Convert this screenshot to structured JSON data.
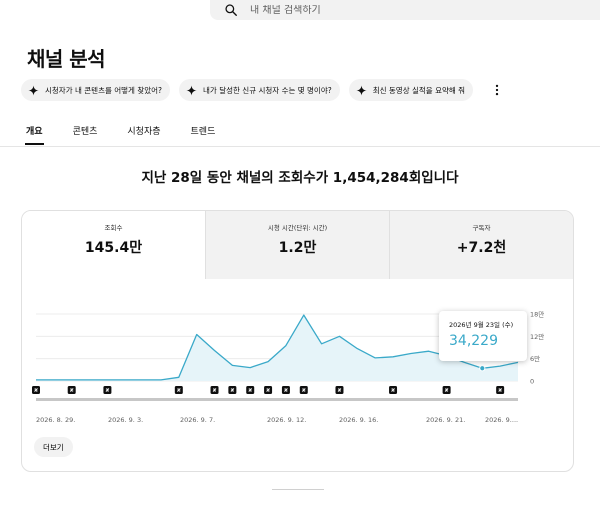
{
  "search": {
    "placeholder": "내 채널 검색하기"
  },
  "page": {
    "title": "채널 분석"
  },
  "chips": [
    {
      "label": "시청자가 내 콘텐츠를 어떻게 찾았어?"
    },
    {
      "label": "내가 달성한 신규 시청자 수는 몇 명이야?"
    },
    {
      "label": "최신 동영상 실적을 요약해 줘"
    }
  ],
  "tabs": [
    {
      "label": "개요",
      "active": true
    },
    {
      "label": "콘텐츠",
      "active": false
    },
    {
      "label": "시청자층",
      "active": false
    },
    {
      "label": "트렌드",
      "active": false
    }
  ],
  "headline": "지난 28일 동안 채널의 조회수가 1,454,284회입니다",
  "metrics": [
    {
      "label": "조회수",
      "value": "145.4만"
    },
    {
      "label": "시청 시간(단위: 시간)",
      "value": "1.2만"
    },
    {
      "label": "구독자",
      "value": "+7.2천"
    }
  ],
  "tooltip": {
    "date": "2026년 9월 23일 (수)",
    "value": "34,229"
  },
  "more_button": "더보기",
  "colors": {
    "line": "#3aa9c9",
    "fill": "#e6f4f9",
    "accent": "#0f0f0f"
  },
  "chart_data": {
    "type": "area",
    "y_ticks": [
      "18만",
      "12만",
      "6만",
      "0"
    ],
    "ylim": [
      0,
      180000
    ],
    "x_tick_labels": [
      "2026. 8. 29.",
      "2026. 9. 3.",
      "2026. 9. 7.",
      "2026. 9. 12.",
      "2026. 9. 16.",
      "2026. 9. 21.",
      "2026. 9...."
    ],
    "values": [
      3000,
      3000,
      3000,
      3000,
      3000,
      3000,
      3000,
      3000,
      10000,
      125000,
      82000,
      42000,
      36000,
      52000,
      95000,
      177000,
      100000,
      120000,
      87000,
      62000,
      65000,
      74000,
      80000,
      68000,
      50000,
      34229,
      40000,
      50000
    ],
    "highlight_index": 25,
    "video_markers": [
      0,
      2,
      4,
      8,
      10,
      11,
      12,
      13,
      14,
      15,
      17,
      20,
      23,
      26
    ],
    "grid": true
  }
}
